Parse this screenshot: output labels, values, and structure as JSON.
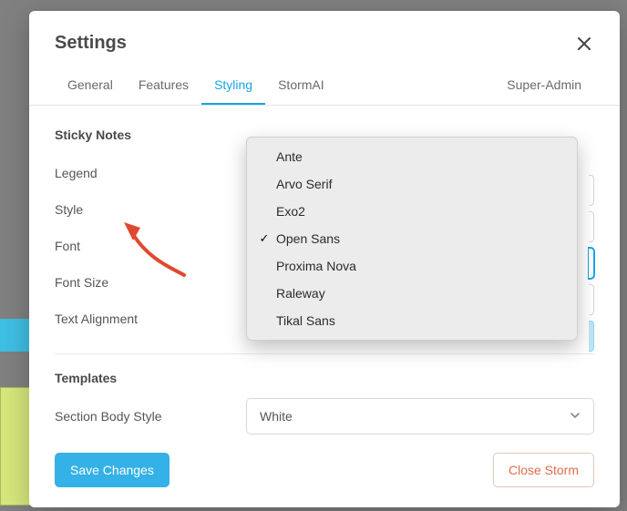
{
  "modal": {
    "title": "Settings"
  },
  "tabs": {
    "items": [
      "General",
      "Features",
      "Styling",
      "StormAI",
      "Super-Admin"
    ],
    "active_index": 2
  },
  "sections": {
    "sticky_notes": {
      "title": "Sticky Notes",
      "rows": {
        "legend": "Legend",
        "style": "Style",
        "font": "Font",
        "font_size": "Font Size",
        "text_alignment": "Text Alignment"
      }
    },
    "templates": {
      "title": "Templates",
      "section_body_style": {
        "label": "Section Body Style",
        "value": "White"
      }
    }
  },
  "font_dropdown": {
    "options": [
      "Ante",
      "Arvo Serif",
      "Exo2",
      "Open Sans",
      "Proxima Nova",
      "Raleway",
      "Tikal Sans"
    ],
    "selected_index": 3
  },
  "footer": {
    "save": "Save Changes",
    "close_storm": "Close Storm"
  }
}
